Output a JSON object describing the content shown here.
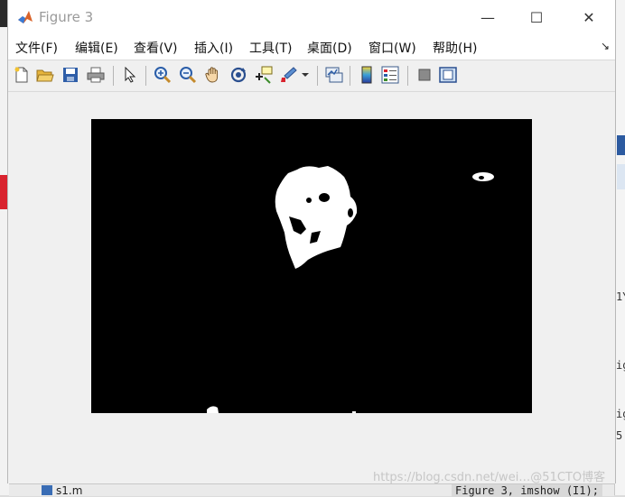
{
  "window": {
    "title": "Figure 3",
    "controls": {
      "minimize": "—",
      "maximize": "☐",
      "close": "✕"
    }
  },
  "menu": [
    {
      "label": "文件(F)"
    },
    {
      "label": "编辑(E)"
    },
    {
      "label": "查看(V)"
    },
    {
      "label": "插入(I)"
    },
    {
      "label": "工具(T)"
    },
    {
      "label": "桌面(D)"
    },
    {
      "label": "窗口(W)"
    },
    {
      "label": "帮助(H)"
    }
  ],
  "toolbar": [
    {
      "name": "new-figure-icon"
    },
    {
      "name": "open-file-icon"
    },
    {
      "name": "save-icon"
    },
    {
      "name": "print-icon"
    },
    {
      "name": "pointer-icon"
    },
    {
      "name": "zoom-in-icon"
    },
    {
      "name": "zoom-out-icon"
    },
    {
      "name": "pan-hand-icon"
    },
    {
      "name": "rotate-3d-icon"
    },
    {
      "name": "data-cursor-icon"
    },
    {
      "name": "brush-icon"
    },
    {
      "name": "link-plot-icon"
    },
    {
      "name": "colorbar-icon"
    },
    {
      "name": "legend-icon"
    },
    {
      "name": "hide-plot-tools-icon"
    },
    {
      "name": "show-plot-tools-icon"
    }
  ],
  "background": {
    "bottom_file": "s1.m",
    "bottom_code": "Figure 3, imshow (I1);",
    "right_fragments": [
      "1Y",
      "ig",
      "ig",
      "5"
    ]
  },
  "watermark": "https://blog.csdn.net/wei…@51CTO博客",
  "colors": {
    "image_background": "#000000",
    "image_foreground": "#ffffff",
    "titlebar": "#ffffff",
    "accent_red": "#d9232e"
  }
}
